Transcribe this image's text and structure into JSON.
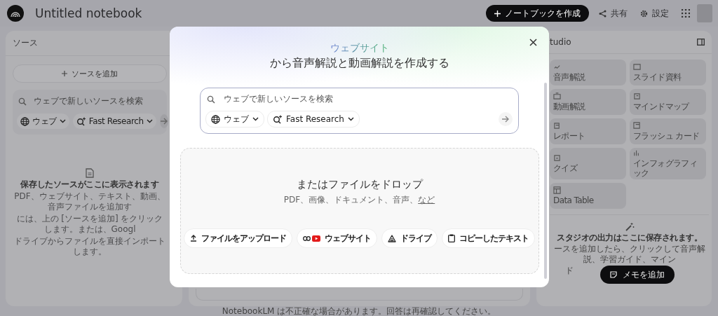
{
  "header": {
    "title": "Untitled notebook",
    "buttons": [
      {
        "label": "ノートブックを作成",
        "kind": "primary"
      },
      {
        "label": "共有",
        "kind": "share"
      },
      {
        "label": "設定",
        "kind": "settings"
      }
    ]
  },
  "sources_panel": {
    "title": "ソース",
    "add_button": "ソースを追加",
    "search": {
      "placeholder": "ウェブで新しいソースを検索",
      "chips": [
        "ウェブ",
        "Fast Research"
      ]
    },
    "empty_title": "保存したソースがここに表示されます",
    "empty_lines": [
      "PDF、ウェブサイト、テキスト、動画、音声ファイルを追加す",
      "には、上の [ソースを追加] をクリックします。または、Googl",
      "ドライブからファイルを直接インポートします。"
    ]
  },
  "studio_panel": {
    "title": "tudio",
    "tiles": [
      "音声解説",
      "スライド資料",
      "動画解説",
      "マインドマップ",
      "レポート",
      "フラッシュ カード",
      "クイズ",
      "インフォグラフィック",
      "Data Table"
    ],
    "empty_title": "スタジオの出力はここに保存されます。",
    "empty_lines": [
      "ースを追加したら、クリックして音声解説、学習ガイド、マイン",
      "ド"
    ],
    "note_button": "メモを追加"
  },
  "modal": {
    "title_accent": "ウェブサイト",
    "title": "から音声解説と動画解説を作成する",
    "search": {
      "placeholder": "ウェブで新しいソースを検索",
      "chips": [
        "ウェブ",
        "Fast Research"
      ]
    },
    "drop_title": "またはファイルをドロップ",
    "drop_subtitle": "PDF、画像、ドキュメント、音声、",
    "drop_link": "など",
    "buttons": [
      {
        "label": "ファイルをアップロード",
        "kind": "upload"
      },
      {
        "label": "ウェブサイト",
        "kind": "website"
      },
      {
        "label": "ドライブ",
        "kind": "drive"
      },
      {
        "label": "コピーしたテキスト",
        "kind": "paste"
      }
    ]
  },
  "footer": "NotebookLM は不正確な場合があります。回答は再確認してください。"
}
